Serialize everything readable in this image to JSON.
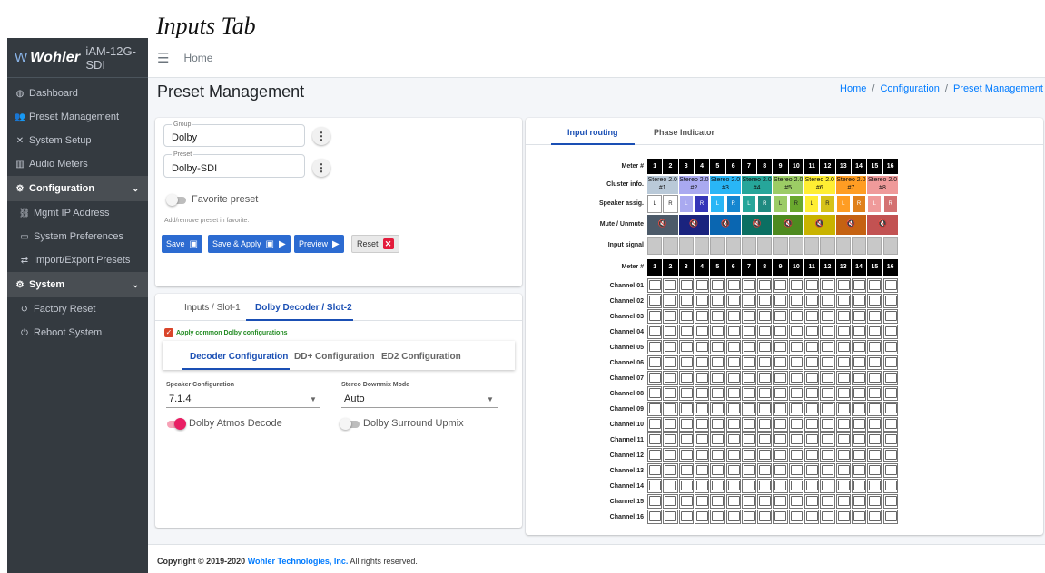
{
  "annotation": {
    "title": "Inputs Tab"
  },
  "sidebar": {
    "brand": {
      "logo": "Wohler",
      "product": "iAM-12G-SDI"
    },
    "items": [
      {
        "label": "Dashboard",
        "icon": "dashboard-icon",
        "glyph": "◍"
      },
      {
        "label": "Preset Management",
        "icon": "users-icon",
        "glyph": "👥"
      },
      {
        "label": "System Setup",
        "icon": "tools-icon",
        "glyph": "✕"
      },
      {
        "label": "Audio Meters",
        "icon": "bar-chart-icon",
        "glyph": "▥"
      },
      {
        "label": "Configuration",
        "icon": "gear-icon",
        "glyph": "⚙",
        "expanded": true
      },
      {
        "label": "Mgmt IP Address",
        "icon": "network-icon",
        "glyph": "⛓"
      },
      {
        "label": "System Preferences",
        "icon": "monitor-icon",
        "glyph": "▭"
      },
      {
        "label": "Import/Export Presets",
        "icon": "swap-icon",
        "glyph": "⇄"
      },
      {
        "label": "System",
        "icon": "gears-icon",
        "glyph": "⚙",
        "expanded": true
      },
      {
        "label": "Factory Reset",
        "icon": "undo-icon",
        "glyph": "↺"
      },
      {
        "label": "Reboot System",
        "icon": "power-icon",
        "glyph": "⏻"
      }
    ]
  },
  "topbar": {
    "home": "Home"
  },
  "page": {
    "title": "Preset Management"
  },
  "breadcrumb": [
    "Home",
    "Configuration",
    "Preset Management"
  ],
  "preset_card": {
    "group": {
      "legend": "Group",
      "value": "Dolby"
    },
    "preset": {
      "legend": "Preset",
      "value": "Dolby-SDI"
    },
    "favorite_label": "Favorite preset",
    "favorite_hint": "Add/remove preset in favorite.",
    "buttons": {
      "save": "Save",
      "save_apply": "Save & Apply",
      "preview": "Preview",
      "reset": "Reset"
    }
  },
  "slot_tabs": [
    "Inputs / Slot-1",
    "Dolby Decoder / Slot-2"
  ],
  "dolby": {
    "apply_common": "Apply common Dolby configurations",
    "subtabs": [
      "Decoder Configuration",
      "DD+ Configuration",
      "ED2 Configuration"
    ],
    "speaker_config": {
      "label": "Speaker Configuration",
      "value": "7.1.4"
    },
    "stereo_downmix": {
      "label": "Stereo Downmix Mode",
      "value": "Auto"
    },
    "atmos_decode": "Dolby Atmos Decode",
    "surround_upmix": "Dolby Surround Upmix"
  },
  "routing": {
    "tabs": [
      "Input routing",
      "Phase Indicator"
    ],
    "row_labels": {
      "meter": "Meter #",
      "cluster": "Cluster info.",
      "speaker": "Speaker assig.",
      "mute": "Mute / Unmute",
      "signal": "Input signal"
    },
    "meters": [
      "1",
      "2",
      "3",
      "4",
      "5",
      "6",
      "7",
      "8",
      "9",
      "10",
      "11",
      "12",
      "13",
      "14",
      "15",
      "16"
    ],
    "clusters": [
      {
        "name": "Stereo 2.0",
        "num": "#1",
        "color": "#b9c9d8",
        "dark": "#7a8a9b",
        "mute": "#4c5a69"
      },
      {
        "name": "Stereo 2.0",
        "num": "#2",
        "color": "#a9a9f0",
        "dark": "#3535b8",
        "mute": "#1a237e"
      },
      {
        "name": "Stereo 2.0",
        "num": "#3",
        "color": "#29b6f6",
        "dark": "#1586d0",
        "mute": "#0a66b1"
      },
      {
        "name": "Stereo 2.0",
        "num": "#4",
        "color": "#26a69a",
        "dark": "#1f8a80",
        "mute": "#0b6f62"
      },
      {
        "name": "Stereo 2.0",
        "num": "#5",
        "color": "#9ccc65",
        "dark": "#6aa82e",
        "mute": "#4e8a1f"
      },
      {
        "name": "Stereo 2.0",
        "num": "#6",
        "color": "#ffee33",
        "dark": "#d6c21a",
        "mute": "#c9b300"
      },
      {
        "name": "Stereo 2.0",
        "num": "#7",
        "color": "#ff9d23",
        "dark": "#e0801a",
        "mute": "#c56212"
      },
      {
        "name": "Stereo 2.0",
        "num": "#8",
        "color": "#ef9a9a",
        "dark": "#d47272",
        "mute": "#c25252"
      }
    ],
    "speakers": [
      "L",
      "R",
      "L",
      "R",
      "L",
      "R",
      "L",
      "R",
      "L",
      "R",
      "L",
      "R",
      "L",
      "R",
      "L",
      "R"
    ],
    "mute_icon": "speaker-mute-icon",
    "channels": [
      "Channel 01",
      "Channel 02",
      "Channel 03",
      "Channel 04",
      "Channel 05",
      "Channel 06",
      "Channel 07",
      "Channel 08",
      "Channel 09",
      "Channel 10",
      "Channel 11",
      "Channel 12",
      "Channel 13",
      "Channel 14",
      "Channel 15",
      "Channel 16"
    ]
  },
  "footer": {
    "prefix": "Copyright © 2019-2020",
    "company": "Wohler Technologies, Inc.",
    "suffix": "All rights reserved."
  }
}
